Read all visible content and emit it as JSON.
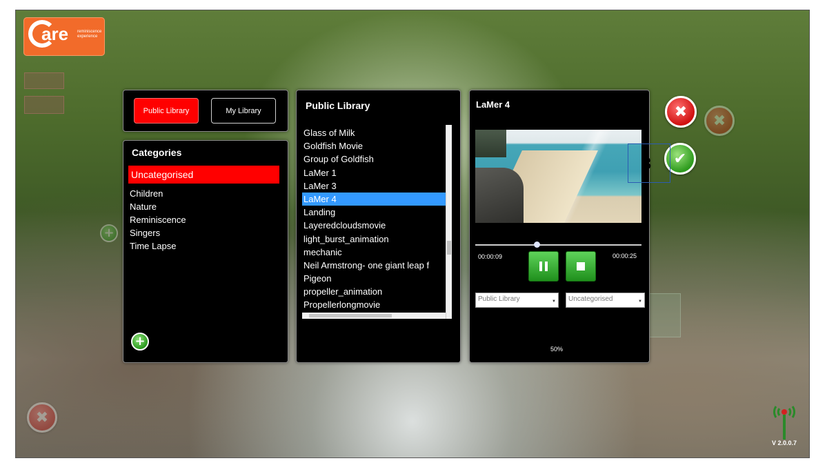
{
  "app": {
    "logo_word": "are",
    "logo_tagline_1": "reminiscence",
    "logo_tagline_2": "experience",
    "version": "V 2.0.0.7"
  },
  "library_tabs": {
    "public_label": "Public Library",
    "my_label": "My Library",
    "active": "Public Library"
  },
  "categories": {
    "title": "Categories",
    "selected": "Uncategorised",
    "items": [
      "Children",
      "Nature",
      "Reminiscence",
      "Singers",
      "Time Lapse"
    ]
  },
  "media_list": {
    "title": "Public Library",
    "items": [
      "Glass of Milk",
      "Goldfish Movie",
      "Group of Goldfish",
      "LaMer 1",
      "LaMer 3",
      "LaMer 4",
      "Landing",
      "Layeredcloudsmovie",
      "light_burst_animation",
      "mechanic",
      "Neil Armstrong- one giant leap f",
      "Pigeon",
      "propeller_animation",
      "Propellerlongmovie"
    ],
    "selected": "LaMer 4"
  },
  "player": {
    "title": "LaMer 4",
    "current_time": "00:00:09",
    "total_time": "00:00:25",
    "progress_fraction": 0.37,
    "library_select": "Public Library",
    "category_select": "Uncategorised",
    "percent": "50%"
  },
  "overlay": {
    "marker_label": "3"
  },
  "colors": {
    "accent_red": "#ff0000",
    "selection_blue": "#3399ff",
    "button_green": "#2e9b1e",
    "logo_orange": "#f26b2a"
  }
}
